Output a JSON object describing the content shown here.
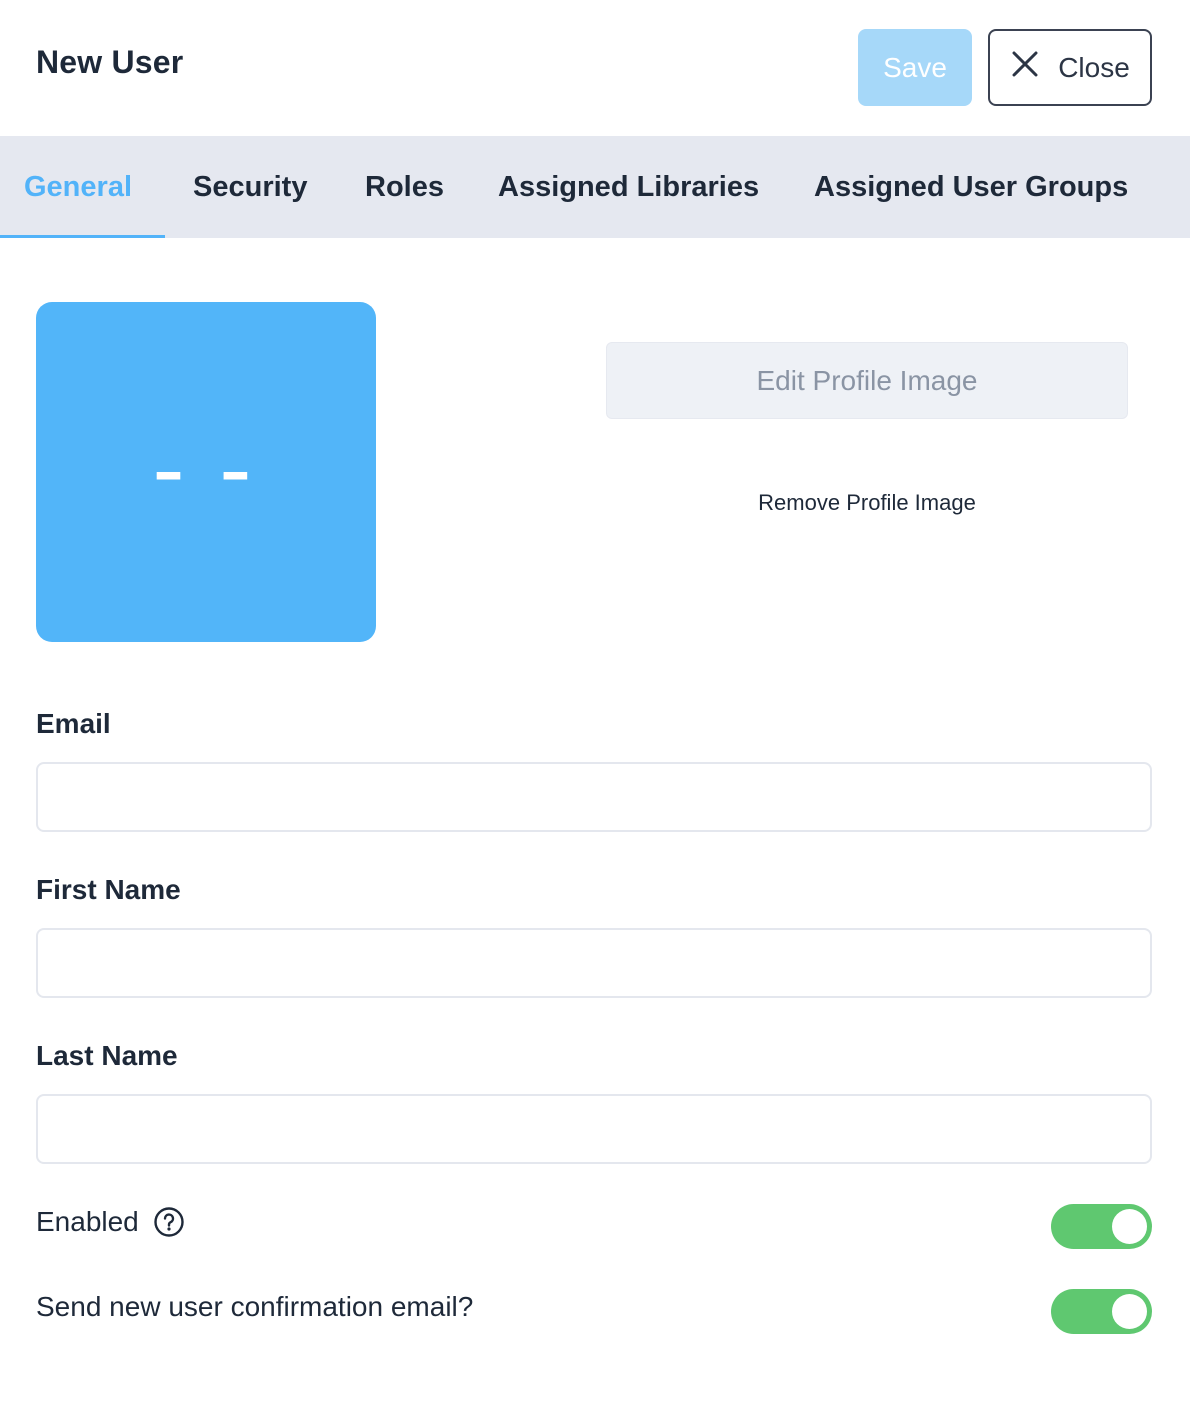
{
  "header": {
    "title": "New User",
    "save_label": "Save",
    "close_label": "Close"
  },
  "tabs": [
    {
      "label": "General",
      "active": true
    },
    {
      "label": "Security",
      "active": false
    },
    {
      "label": "Roles",
      "active": false
    },
    {
      "label": "Assigned Libraries",
      "active": false
    },
    {
      "label": "Assigned User Groups",
      "active": false
    }
  ],
  "profile": {
    "avatar_initials": "– –",
    "edit_image_label": "Edit Profile Image",
    "remove_image_label": "Remove Profile Image"
  },
  "form": {
    "email": {
      "label": "Email",
      "value": ""
    },
    "first_name": {
      "label": "First Name",
      "value": ""
    },
    "last_name": {
      "label": "Last Name",
      "value": ""
    },
    "enabled": {
      "label": "Enabled",
      "on": true
    },
    "send_confirmation": {
      "label": "Send new user confirmation email?",
      "on": true
    }
  },
  "colors": {
    "accent": "#52b3f9",
    "avatar_bg": "#52b5f9",
    "save_disabled_bg": "#a6d8f9",
    "toggle_on": "#5fc870",
    "tabbar_bg": "#e5e8f0",
    "text": "#1e2939"
  },
  "icons": {
    "close": "close-icon",
    "help": "question-circle-icon"
  }
}
